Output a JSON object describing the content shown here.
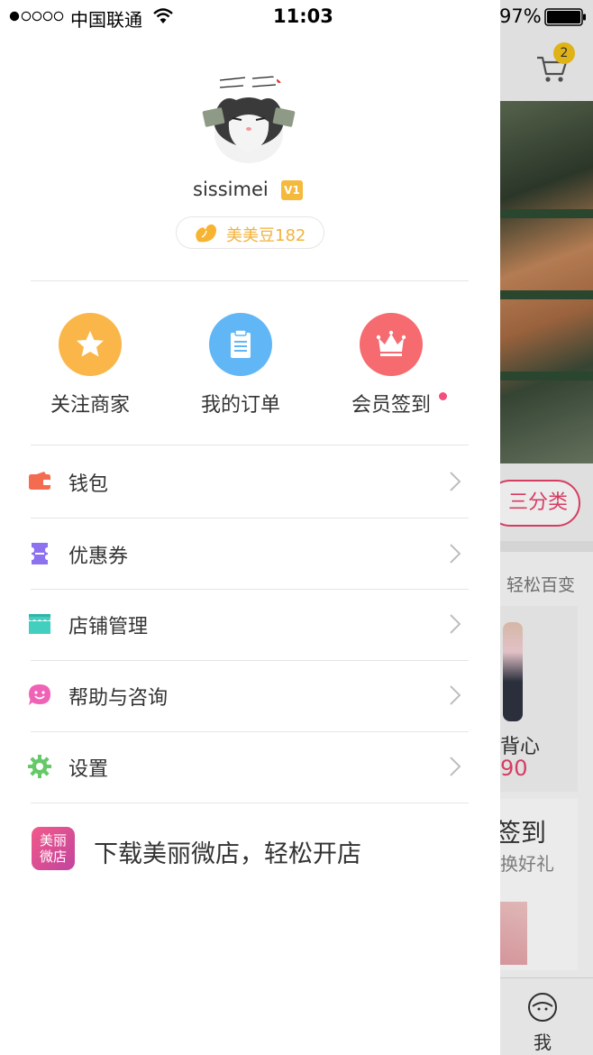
{
  "status_bar": {
    "carrier": "中国联通",
    "time": "11:03",
    "battery": "97%"
  },
  "profile": {
    "username": "sissimei",
    "vip_level": "V1",
    "beans": "美美豆182"
  },
  "quick_actions": [
    {
      "label": "关注商家",
      "icon": "star-icon",
      "color": "#fbb64a"
    },
    {
      "label": "我的订单",
      "icon": "clipboard-icon",
      "color": "#61b6f5"
    },
    {
      "label": "会员签到",
      "icon": "crown-icon",
      "color": "#f66b70"
    }
  ],
  "menu": [
    {
      "label": "钱包",
      "icon": "wallet-icon"
    },
    {
      "label": "优惠券",
      "icon": "coupon-icon"
    },
    {
      "label": "店铺管理",
      "icon": "store-icon"
    },
    {
      "label": "帮助与咨询",
      "icon": "chat-smile-icon"
    },
    {
      "label": "设置",
      "icon": "gear-icon"
    }
  ],
  "promo": {
    "logo_text_line1": "美丽",
    "logo_text_line2": "微店",
    "text": "下载美丽微店，轻松开店"
  },
  "background_app": {
    "cart_count": "2",
    "category_button": "三分类",
    "easy_text": "轻松百变",
    "vest_text": "背心",
    "price_text": "90",
    "signin_text": "签到",
    "gift_text": "换好礼",
    "tab_me": "我"
  }
}
